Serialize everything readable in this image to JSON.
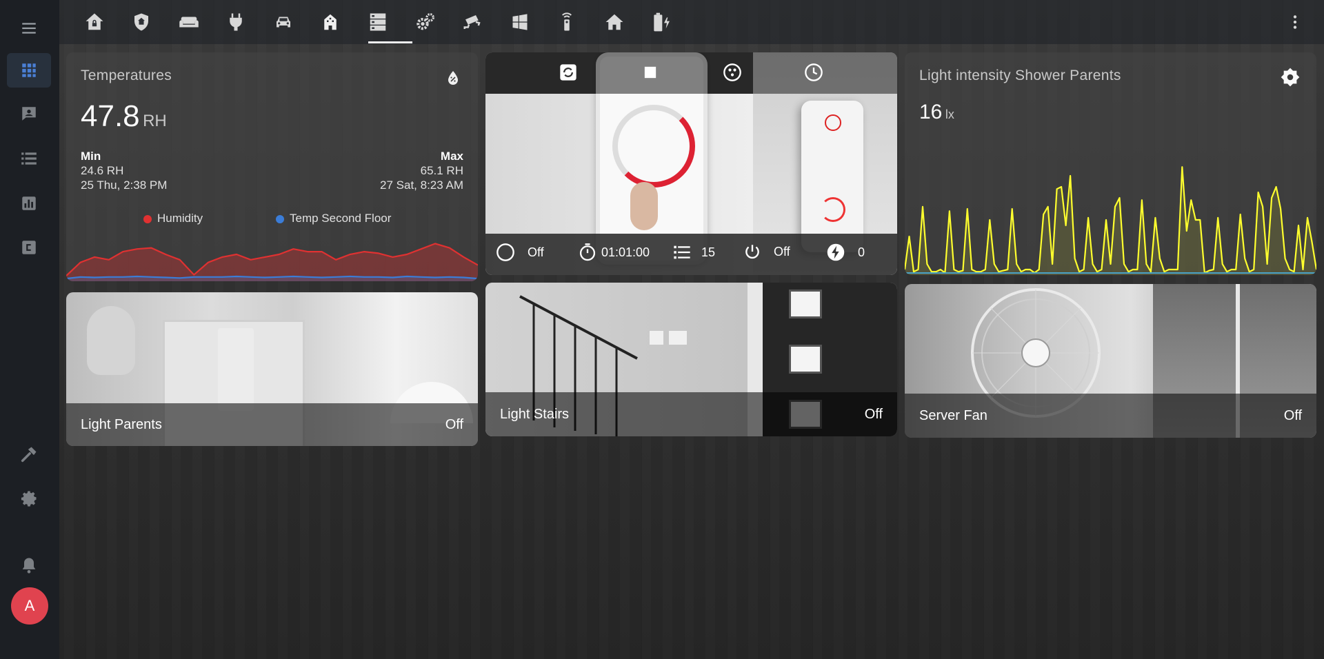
{
  "user": {
    "initial": "A"
  },
  "toolbar": {
    "tabs": [
      {
        "icon": "home-lock-icon"
      },
      {
        "icon": "shield-home-icon"
      },
      {
        "icon": "sofa-icon"
      },
      {
        "icon": "power-plug-icon"
      },
      {
        "icon": "car-icon"
      },
      {
        "icon": "building-icon",
        "active": true
      },
      {
        "icon": "server-icon"
      },
      {
        "icon": "cogs-icon"
      },
      {
        "icon": "cctv-icon"
      },
      {
        "icon": "windows-icon"
      },
      {
        "icon": "remote-icon"
      },
      {
        "icon": "house-icon"
      },
      {
        "icon": "battery-charging-icon"
      }
    ],
    "menu_icon": "dots-vertical-icon"
  },
  "sidebar": {
    "items": [
      {
        "icon": "grid-icon",
        "active": true
      },
      {
        "icon": "chat-icon"
      },
      {
        "icon": "list-icon"
      },
      {
        "icon": "chart-bar-icon"
      },
      {
        "icon": "code-box-icon"
      },
      {
        "icon": "hammer-icon"
      },
      {
        "icon": "settings-icon"
      },
      {
        "icon": "bell-icon"
      }
    ]
  },
  "temperatures_card": {
    "title": "Temperatures",
    "value": "47.8",
    "unit": "RH",
    "min_label": "Min",
    "min_value": "24.6 RH",
    "min_time": "25 Thu, 2:38 PM",
    "max_label": "Max",
    "max_value": "65.1 RH",
    "max_time": "27 Sat, 8:23 AM",
    "legend": [
      {
        "name": "Humidity",
        "color": "#e03131"
      },
      {
        "name": "Temp Second Floor",
        "color": "#3b7dd8"
      }
    ]
  },
  "shower_card": {
    "title": "Light intensity Shower Parents",
    "value": "16",
    "unit": "lx",
    "line_color": "#ffff2e"
  },
  "timer_card": {
    "top_icons": [
      "timer-refresh-icon",
      "stop-icon",
      "dots-circle-icon",
      "clock-icon"
    ],
    "controls": [
      {
        "icon": "theme-icon",
        "value": "Off"
      },
      {
        "icon": "timer-icon",
        "value": "01:01:00"
      },
      {
        "icon": "list-icon",
        "value": "15"
      },
      {
        "icon": "power-icon",
        "value": "Off"
      },
      {
        "icon": "flash-icon",
        "value": "0"
      }
    ]
  },
  "light_parents": {
    "name": "Light Parents",
    "state": "Off"
  },
  "light_stairs": {
    "name": "Light Stairs",
    "state": "Off"
  },
  "server_fan": {
    "name": "Server Fan",
    "state": "Off"
  },
  "chart_data": [
    {
      "type": "area",
      "series": [
        {
          "name": "Humidity",
          "color": "#e03131",
          "values": [
            0.1,
            0.35,
            0.45,
            0.4,
            0.55,
            0.6,
            0.62,
            0.5,
            0.4,
            0.12,
            0.35,
            0.45,
            0.5,
            0.4,
            0.45,
            0.5,
            0.6,
            0.55,
            0.55,
            0.4,
            0.5,
            0.55,
            0.52,
            0.45,
            0.5,
            0.6,
            0.7,
            0.62,
            0.45,
            0.3
          ]
        },
        {
          "name": "Temp Second Floor",
          "color": "#3b7dd8",
          "values": [
            0.05,
            0.08,
            0.07,
            0.08,
            0.08,
            0.09,
            0.08,
            0.07,
            0.06,
            0.08,
            0.08,
            0.08,
            0.09,
            0.08,
            0.07,
            0.08,
            0.09,
            0.08,
            0.07,
            0.08,
            0.09,
            0.08,
            0.08,
            0.07,
            0.09,
            0.08,
            0.07,
            0.08,
            0.07,
            0.05
          ]
        }
      ]
    },
    {
      "type": "line",
      "series": [
        {
          "name": "",
          "color": "#ffff2e",
          "values": [
            0.05,
            0.35,
            0.03,
            0.05,
            0.62,
            0.1,
            0.03,
            0.03,
            0.05,
            0.02,
            0.58,
            0.05,
            0.03,
            0.04,
            0.6,
            0.05,
            0.03,
            0.03,
            0.05,
            0.5,
            0.1,
            0.03,
            0.04,
            0.05,
            0.6,
            0.1,
            0.03,
            0.05,
            0.05,
            0.02,
            0.05,
            0.55,
            0.62,
            0.1,
            0.78,
            0.8,
            0.45,
            0.9,
            0.15,
            0.03,
            0.05,
            0.52,
            0.1,
            0.03,
            0.05,
            0.5,
            0.1,
            0.62,
            0.7,
            0.1,
            0.03,
            0.05,
            0.05,
            0.68,
            0.1,
            0.03,
            0.52,
            0.15,
            0.03,
            0.05,
            0.05,
            0.05,
            0.98,
            0.4,
            0.68,
            0.5,
            0.5,
            0.02,
            0.04,
            0.05,
            0.52,
            0.1,
            0.03,
            0.05,
            0.05,
            0.55,
            0.15,
            0.03,
            0.05,
            0.75,
            0.62,
            0.1,
            0.7,
            0.8,
            0.6,
            0.15,
            0.05,
            0.03,
            0.45,
            0.05,
            0.52,
            0.3,
            0.05
          ]
        }
      ]
    }
  ]
}
